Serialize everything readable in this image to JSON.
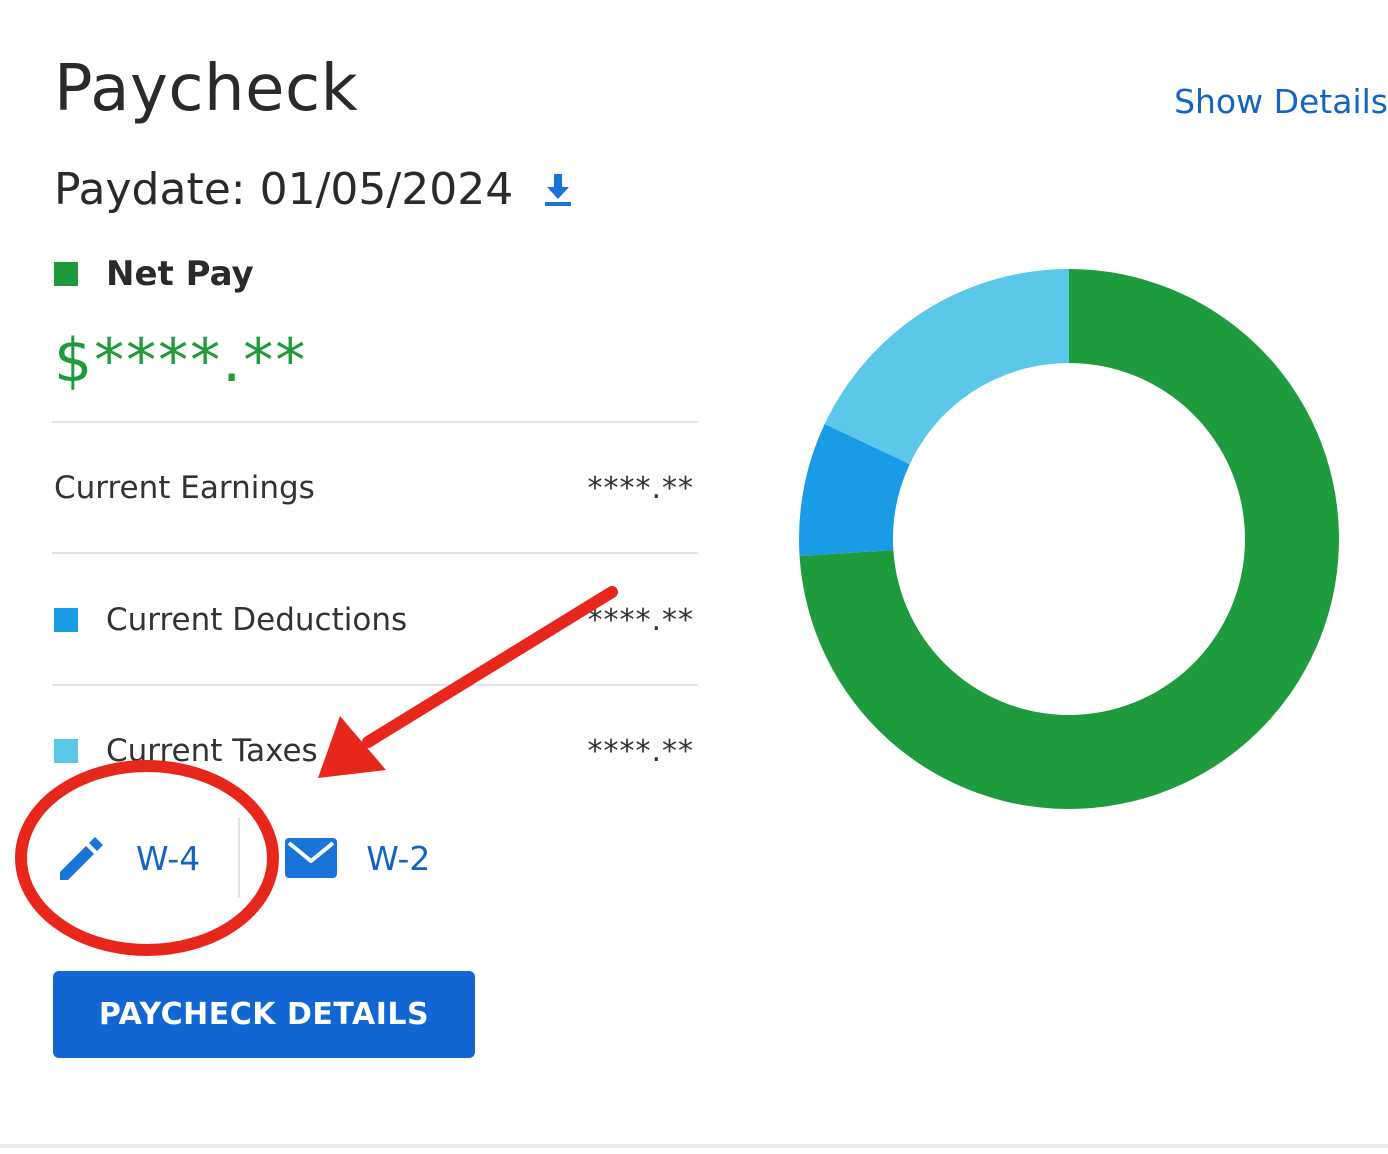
{
  "header": {
    "title": "Paycheck",
    "show_details": "Show Details"
  },
  "paydate": {
    "text": "Paydate: 01/05/2024"
  },
  "net_pay": {
    "label": "Net Pay",
    "amount": "$****.**",
    "color": "#1e9b3c"
  },
  "rows": [
    {
      "label": "Current Earnings",
      "value": "****.**"
    },
    {
      "label": "Current Deductions",
      "value": "****.**",
      "color": "#1a9be6"
    },
    {
      "label": "Current Taxes",
      "value": "****.**",
      "color": "#5bc8ea"
    }
  ],
  "links": {
    "w4": "W-4",
    "w2": "W-2"
  },
  "button": {
    "label": "PAYCHECK DETAILS"
  },
  "chart_data": {
    "type": "pie",
    "donut": true,
    "segments": [
      {
        "name": "Net Pay",
        "value": 74,
        "color": "#1e9b3c"
      },
      {
        "name": "Current Deductions",
        "value": 8,
        "color": "#1a9be6"
      },
      {
        "name": "Current Taxes",
        "value": 18,
        "color": "#5bc8ea"
      }
    ]
  },
  "annotation": {
    "highlight": "w4",
    "color": "#e8271c"
  }
}
